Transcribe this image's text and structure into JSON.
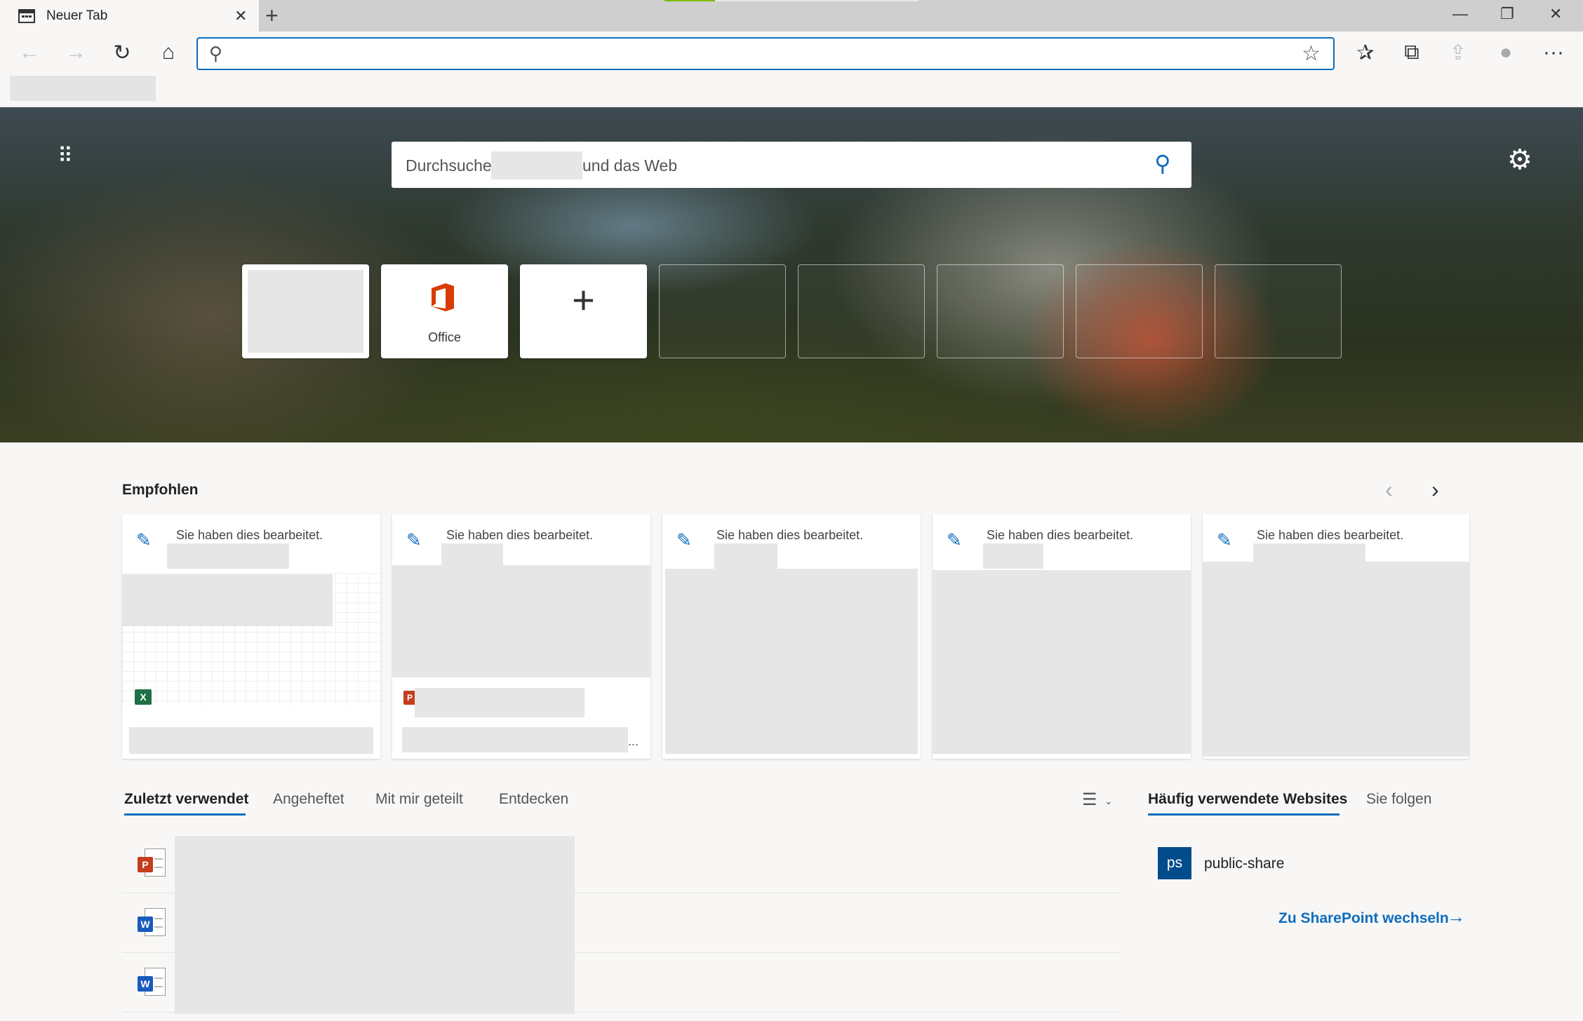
{
  "tab": {
    "title": "Neuer Tab",
    "close": "✕",
    "new": "+"
  },
  "window": {
    "minimize": "—",
    "restore": "❐",
    "close": "✕"
  },
  "toolbar": {
    "back": "←",
    "forward": "→",
    "refresh": "↻",
    "home": "⌂",
    "address_value": "",
    "favorite": "☆",
    "favorites": "✰",
    "collections": "⧉",
    "share": "⇪",
    "profile": "●",
    "more": "···"
  },
  "hero": {
    "apps": "⠿",
    "settings": "⚙",
    "search_prefix": "Durchsuche",
    "search_suffix": "und das Web",
    "search_icon": "⚲",
    "tiles": {
      "office_label": "Office",
      "add": "+"
    }
  },
  "recommended": {
    "title": "Empfohlen",
    "prev": "‹",
    "next": "›",
    "card_title": "Sie haben dies bearbeitet.",
    "pencil": "✎",
    "more": "..."
  },
  "files_tabs": [
    "Zuletzt verwendet",
    "Angeheftet",
    "Mit mir geteilt",
    "Entdecken"
  ],
  "sort": {
    "icon": "☰",
    "chevron": "⌄"
  },
  "sites_tabs": [
    "Häufig verwendete Websites",
    "Sie folgen"
  ],
  "site": {
    "badge": "ps",
    "name": "public-share"
  },
  "sharepoint_link": "Zu SharePoint wechseln",
  "sharepoint_arrow": "→",
  "file_badges": {
    "ppt": "P",
    "word": "W",
    "excel": "X"
  },
  "colors": {
    "accent": "#0f6cbd",
    "office": "#d83b01",
    "site_badge": "#034c8c"
  }
}
